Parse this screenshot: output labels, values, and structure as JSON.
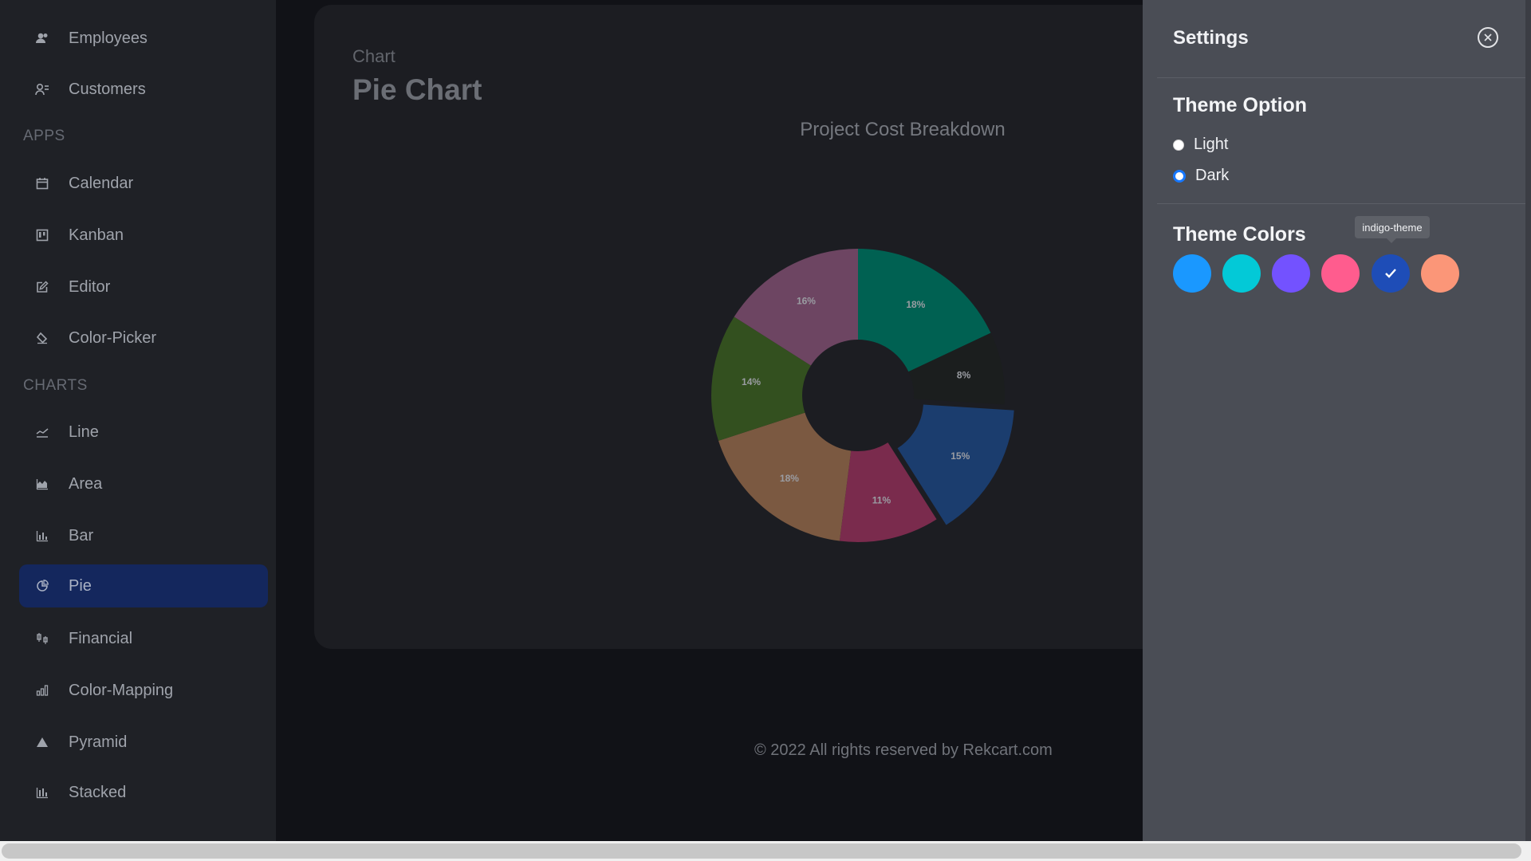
{
  "sidebar": {
    "items_top": [
      {
        "label": "Employees",
        "icon": "employees-icon"
      },
      {
        "label": "Customers",
        "icon": "customers-icon"
      }
    ],
    "apps_title": "APPS",
    "apps": [
      {
        "label": "Calendar",
        "icon": "calendar-icon"
      },
      {
        "label": "Kanban",
        "icon": "kanban-icon"
      },
      {
        "label": "Editor",
        "icon": "editor-icon"
      },
      {
        "label": "Color-Picker",
        "icon": "color-picker-icon"
      }
    ],
    "charts_title": "CHARTS",
    "charts": [
      {
        "label": "Line",
        "icon": "line-chart-icon"
      },
      {
        "label": "Area",
        "icon": "area-chart-icon"
      },
      {
        "label": "Bar",
        "icon": "bar-chart-icon"
      },
      {
        "label": "Pie",
        "icon": "pie-chart-icon",
        "active": true
      },
      {
        "label": "Financial",
        "icon": "financial-icon"
      },
      {
        "label": "Color-Mapping",
        "icon": "color-mapping-icon"
      },
      {
        "label": "Pyramid",
        "icon": "pyramid-icon"
      },
      {
        "label": "Stacked",
        "icon": "stacked-chart-icon"
      }
    ]
  },
  "header": {
    "category": "Chart",
    "title": "Pie Chart"
  },
  "chart_data": {
    "type": "pie",
    "title": "Project Cost Breakdown",
    "donut": true,
    "slices": [
      {
        "label": "18%",
        "value": 18,
        "color": "#006152"
      },
      {
        "label": "8%",
        "value": 8,
        "color": "#1b1e1e"
      },
      {
        "label": "15%",
        "value": 15,
        "color": "#1b3d6e",
        "exploded": true
      },
      {
        "label": "11%",
        "value": 11,
        "color": "#7a2b4d"
      },
      {
        "label": "18%",
        "value": 18,
        "color": "#7b5941"
      },
      {
        "label": "14%",
        "value": 14,
        "color": "#33501f"
      },
      {
        "label": "16%",
        "value": 16,
        "color": "#6d4562"
      }
    ]
  },
  "footer": {
    "text": "© 2022 All rights reserved by Rekcart.com"
  },
  "settings": {
    "title": "Settings",
    "theme_option_title": "Theme Option",
    "options": [
      {
        "label": "Light",
        "selected": false
      },
      {
        "label": "Dark",
        "selected": true
      }
    ],
    "theme_colors_title": "Theme Colors",
    "tooltip": "indigo-theme",
    "colors": [
      {
        "name": "blue-theme",
        "hex": "#1a98ff"
      },
      {
        "name": "teal-theme",
        "hex": "#03c9d7"
      },
      {
        "name": "purple-theme",
        "hex": "#7352ff"
      },
      {
        "name": "pink-theme",
        "hex": "#ff5c8e"
      },
      {
        "name": "indigo-theme",
        "hex": "#1e4db7",
        "selected": true
      },
      {
        "name": "orange-theme",
        "hex": "#fb9678"
      }
    ]
  }
}
